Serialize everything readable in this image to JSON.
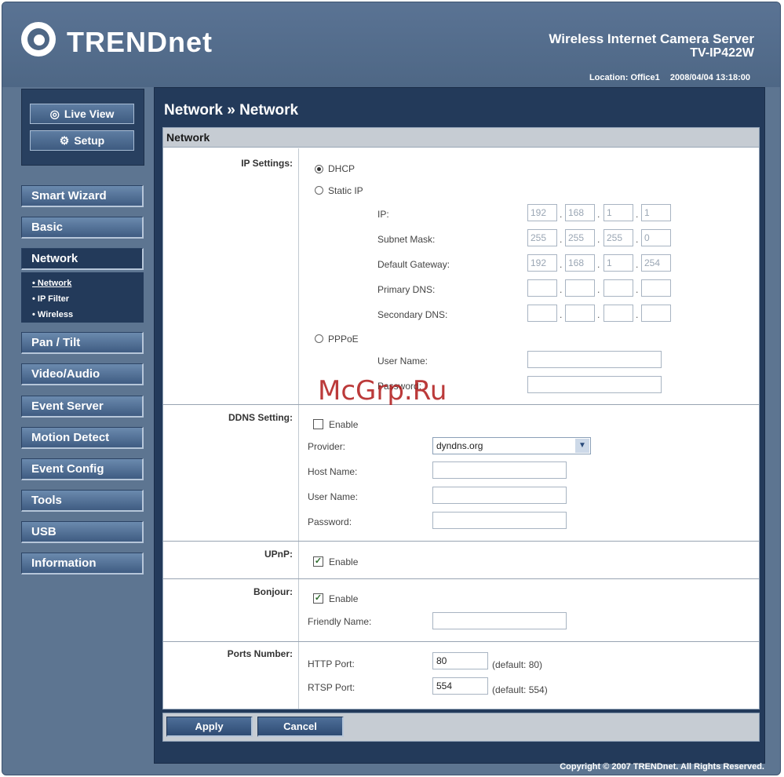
{
  "header": {
    "logo_text": "TRENDnet",
    "product_title": "Wireless Internet Camera Server",
    "product_model": "TV-IP422W",
    "location": "Location: Office1",
    "datetime": "2008/04/04 13:18:00"
  },
  "view_buttons": {
    "live_view": "Live View",
    "setup": "Setup"
  },
  "nav": {
    "items": [
      "Smart Wizard",
      "Basic",
      "Network",
      "Pan / Tilt",
      "Video/Audio",
      "Event Server",
      "Motion Detect",
      "Event Config",
      "Tools",
      "USB",
      "Information"
    ],
    "active": "Network",
    "network_sub": [
      "• Network",
      "• IP Filter",
      "• Wireless"
    ]
  },
  "main": {
    "title": "Network » Network",
    "section": "Network"
  },
  "ip_settings": {
    "label": "IP Settings:",
    "dhcp": "DHCP",
    "static_ip": "Static IP",
    "pppoe": "PPPoE",
    "selected": "DHCP",
    "ip_label": "IP:",
    "ip": [
      "192",
      "168",
      "1",
      "1"
    ],
    "mask_label": "Subnet Mask:",
    "mask": [
      "255",
      "255",
      "255",
      "0"
    ],
    "gw_label": "Default Gateway:",
    "gw": [
      "192",
      "168",
      "1",
      "254"
    ],
    "dns1_label": "Primary DNS:",
    "dns2_label": "Secondary DNS:",
    "pppoe_user_label": "User Name:",
    "pppoe_pass_label": "Password:"
  },
  "ddns": {
    "label": "DDNS Setting:",
    "enable": "Enable",
    "provider_label": "Provider:",
    "provider": "dyndns.org",
    "host_label": "Host Name:",
    "user_label": "User Name:",
    "pass_label": "Password:"
  },
  "upnp": {
    "label": "UPnP:",
    "enable": "Enable"
  },
  "bonjour": {
    "label": "Bonjour:",
    "enable": "Enable",
    "friendly_label": "Friendly Name:"
  },
  "ports": {
    "label": "Ports Number:",
    "http_label": "HTTP Port:",
    "http": "80",
    "http_default": "(default: 80)",
    "rtsp_label": "RTSP Port:",
    "rtsp": "554",
    "rtsp_default": "(default: 554)"
  },
  "actions": {
    "apply": "Apply",
    "cancel": "Cancel"
  },
  "footer": {
    "copyright": "Copyright © 2007 TRENDnet. All Rights Reserved."
  },
  "watermark": "McGrp.Ru"
}
